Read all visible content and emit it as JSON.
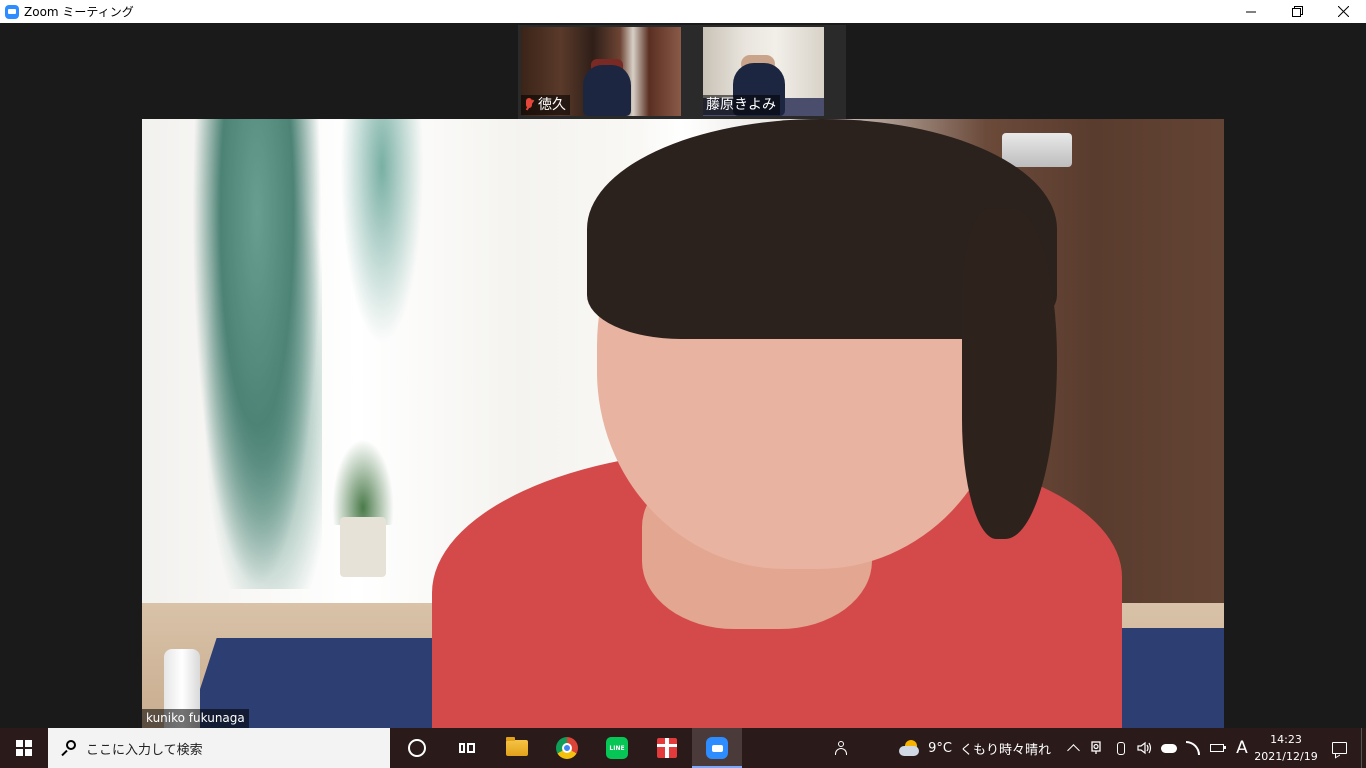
{
  "window": {
    "title": "Zoom ミーティング",
    "icons": [
      "zoom-logo-icon",
      "minimize-icon",
      "restore-icon",
      "close-icon"
    ]
  },
  "meeting": {
    "thumbnails": [
      {
        "name": "徳久",
        "muted": true
      },
      {
        "name": "藤原きよみ",
        "muted": false
      }
    ],
    "speaker": {
      "name": "kuniko fukunaga"
    }
  },
  "taskbar": {
    "search_placeholder": "ここに入力して検索",
    "apps": [
      "cortana-icon",
      "task-view-icon",
      "file-explorer-icon",
      "chrome-icon",
      "line-icon",
      "gift-icon",
      "zoom-icon"
    ],
    "active_app": "zoom-icon",
    "weather": {
      "temp": "9°C",
      "condition": "くもり時々晴れ"
    },
    "ime": "A",
    "clock": {
      "time": "14:23",
      "date": "2021/12/19"
    }
  },
  "colors": {
    "zoom_blue": "#2d8cff",
    "meeting_bg": "#1a1a1a",
    "muted_red": "#e5463a",
    "line_green": "#06c755"
  }
}
